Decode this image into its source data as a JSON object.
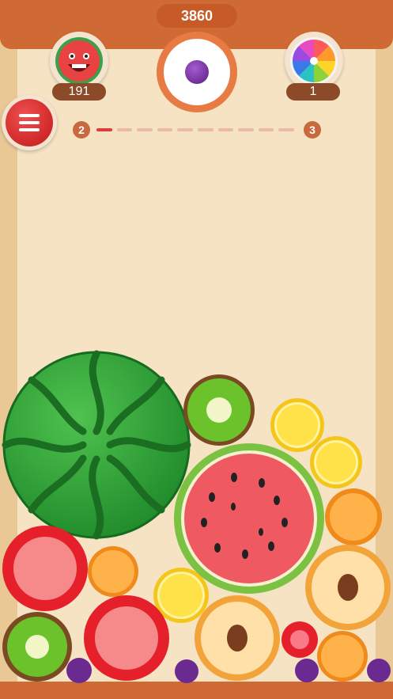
{
  "score": "3860",
  "next_fruit": "grape-icon",
  "powerups": {
    "left": {
      "icon": "watermelon-face-icon",
      "count": "191"
    },
    "right": {
      "icon": "color-wheel-icon",
      "count": "1"
    }
  },
  "progress": {
    "from_level": "2",
    "to_level": "3",
    "fraction": 0.1
  },
  "menu": {
    "icon": "menu-list-icon"
  },
  "colors": {
    "frame": "#d06a34",
    "board": "#f6e3c4",
    "accent_red": "#e03a3a"
  }
}
